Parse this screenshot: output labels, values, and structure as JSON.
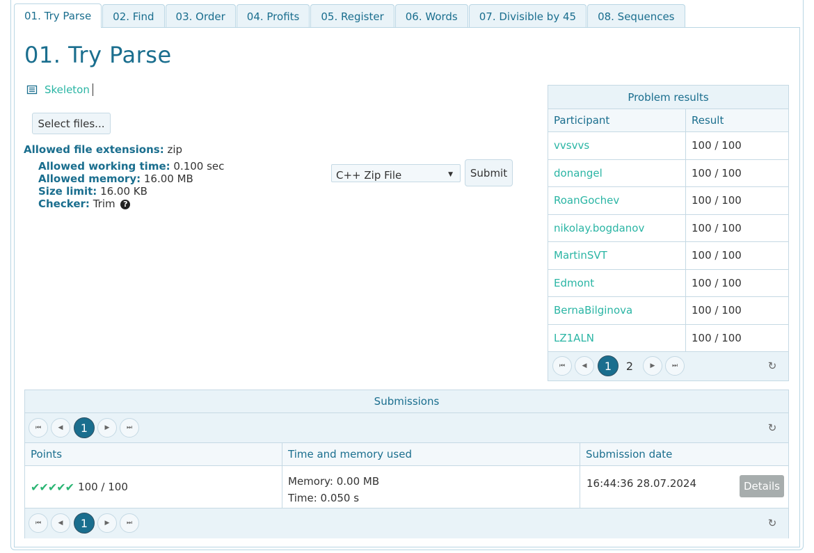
{
  "tabs": [
    {
      "label": "01. Try Parse"
    },
    {
      "label": "02. Find"
    },
    {
      "label": "03. Order"
    },
    {
      "label": "04. Profits"
    },
    {
      "label": "05. Register"
    },
    {
      "label": "06. Words"
    },
    {
      "label": "07. Divisible by 45"
    },
    {
      "label": "08. Sequences"
    }
  ],
  "problem": {
    "title": "01. Try Parse",
    "skeleton_label": "Skeleton",
    "select_files_label": "Select files...",
    "allowed_ext_label": "Allowed file extensions:",
    "allowed_ext_value": "zip",
    "working_time_label": "Allowed working time:",
    "working_time_value": "0.100 sec",
    "memory_label": "Allowed memory:",
    "memory_value": "16.00 MB",
    "size_label": "Size limit:",
    "size_value": "16.00 KB",
    "checker_label": "Checker:",
    "checker_value": "Trim",
    "language_selected": "C++ Zip File",
    "submit_label": "Submit"
  },
  "results": {
    "title": "Problem results",
    "col_participant": "Participant",
    "col_result": "Result",
    "rows": [
      {
        "participant": "vvsvvs",
        "result": "100 / 100"
      },
      {
        "participant": "donangel",
        "result": "100 / 100"
      },
      {
        "participant": "RoanGochev",
        "result": "100 / 100"
      },
      {
        "participant": "nikolay.bogdanov",
        "result": "100 / 100"
      },
      {
        "participant": "MartinSVT",
        "result": "100 / 100"
      },
      {
        "participant": "Edmont",
        "result": "100 / 100"
      },
      {
        "participant": "BernaBilginova",
        "result": "100 / 100"
      },
      {
        "participant": "LZ1ALN",
        "result": "100 / 100"
      }
    ],
    "pages": [
      "1",
      "2"
    ]
  },
  "submissions": {
    "title": "Submissions",
    "page": "1",
    "col_points": "Points",
    "col_time": "Time and memory used",
    "col_date": "Submission date",
    "rows": [
      {
        "checks": "✔✔✔✔✔",
        "points": "100 / 100",
        "memory": "Memory: 0.00 MB",
        "time": "Time: 0.050 s",
        "date": "16:44:36 28.07.2024",
        "details_label": "Details"
      }
    ]
  },
  "icons": {
    "first": "⏮",
    "prev": "◀",
    "next": "▶",
    "last": "⏭",
    "refresh": "↻",
    "help": "?",
    "list": "list-icon",
    "dropdown": "▼"
  },
  "colors": {
    "accent": "#1a6e8e",
    "link": "#2ab5a4",
    "check": "#2ab573",
    "border": "#c5d9e4"
  }
}
